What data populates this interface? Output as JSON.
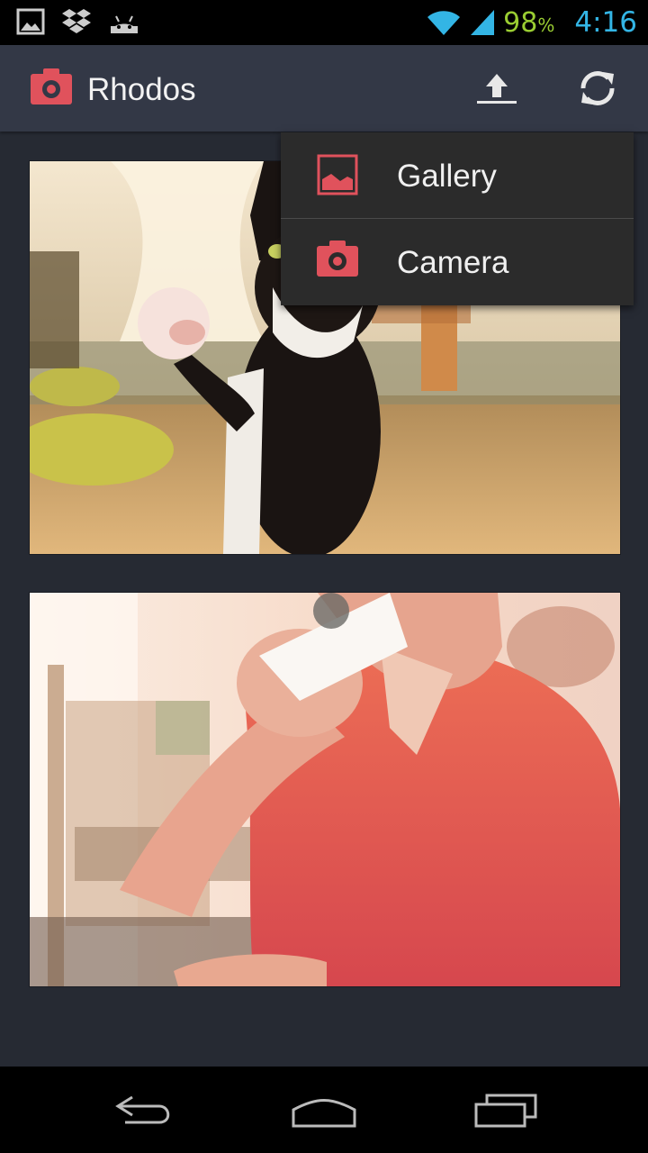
{
  "status_bar": {
    "battery": "98",
    "battery_unit": "%",
    "time": "4:16",
    "notification_icons": [
      "image-icon",
      "dropbox-icon",
      "android-icon"
    ],
    "system_icons": [
      "wifi-icon",
      "signal-icon"
    ]
  },
  "action_bar": {
    "title": "Rhodos",
    "app_icon": "camera-icon",
    "actions": [
      "upload-icon",
      "refresh-icon"
    ]
  },
  "dropdown": {
    "items": [
      {
        "label": "Gallery",
        "icon": "gallery-icon"
      },
      {
        "label": "Camera",
        "icon": "camera-icon"
      }
    ]
  },
  "feed": {
    "photos": [
      "cat-photo",
      "coffee-photo"
    ]
  },
  "colors": {
    "accent": "#e0525c",
    "action_bar": "#333846",
    "background": "#262a33",
    "time_blue": "#33b5e5",
    "battery_green": "#9acd32"
  }
}
